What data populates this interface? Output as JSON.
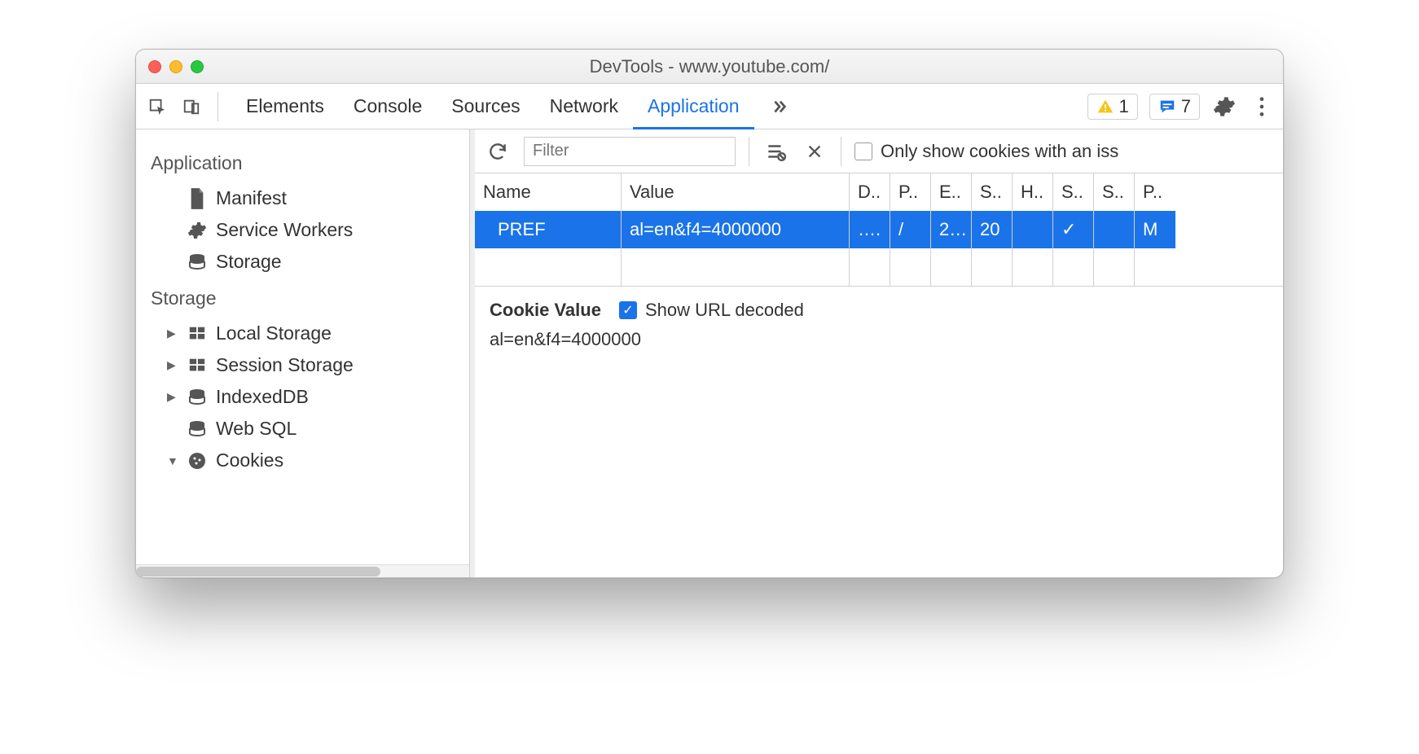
{
  "window_title": "DevTools - www.youtube.com/",
  "tabs": [
    "Elements",
    "Console",
    "Sources",
    "Network",
    "Application"
  ],
  "active_tab": "Application",
  "warnings_count": "1",
  "messages_count": "7",
  "sidebar": {
    "sections": [
      {
        "title": "Application",
        "items": [
          {
            "icon": "file",
            "label": "Manifest"
          },
          {
            "icon": "gear",
            "label": "Service Workers"
          },
          {
            "icon": "db",
            "label": "Storage"
          }
        ]
      },
      {
        "title": "Storage",
        "items": [
          {
            "icon": "grid",
            "label": "Local Storage",
            "expandable": true
          },
          {
            "icon": "grid",
            "label": "Session Storage",
            "expandable": true
          },
          {
            "icon": "db",
            "label": "IndexedDB",
            "expandable": true
          },
          {
            "icon": "db",
            "label": "Web SQL"
          },
          {
            "icon": "cookie",
            "label": "Cookies",
            "expandable": true,
            "open": true
          }
        ]
      }
    ]
  },
  "main": {
    "filter_placeholder": "Filter",
    "only_issues_label": "Only show cookies with an iss",
    "columns": [
      "Name",
      "Value",
      "D..",
      "P..",
      "E..",
      "S..",
      "H..",
      "S..",
      "S..",
      "P.."
    ],
    "row": {
      "name": "PREF",
      "value": "al=en&f4=4000000",
      "d": "….",
      "p": "/",
      "e": "2…",
      "s": "20",
      "h": "",
      "s2": "✓",
      "s3": "",
      "pr": "M"
    },
    "detail_title": "Cookie Value",
    "decoded_label": "Show URL decoded",
    "decoded_checked": true,
    "detail_value": "al=en&f4=4000000"
  }
}
